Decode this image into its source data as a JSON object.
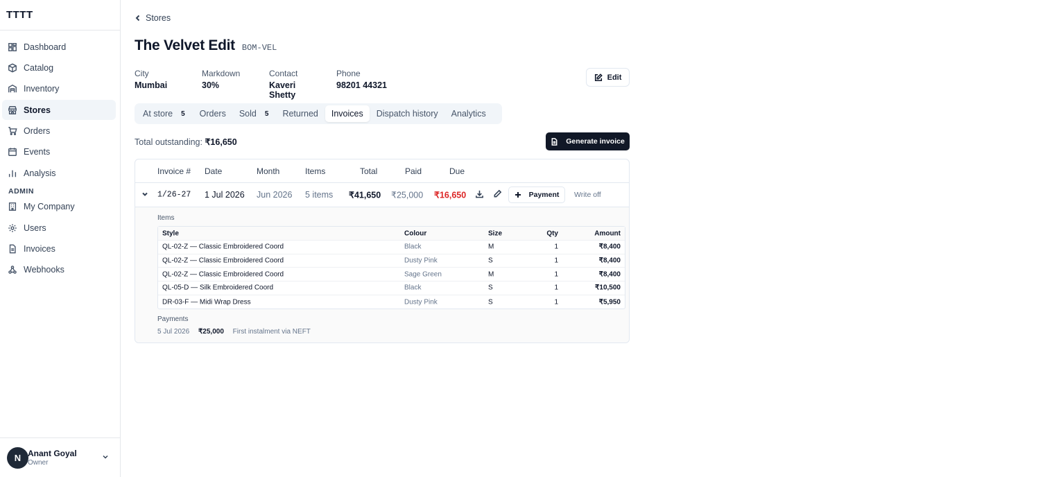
{
  "app": {
    "brand": "TTTT"
  },
  "sidebar": {
    "items": [
      {
        "label": "Dashboard",
        "icon": "dashboard-icon"
      },
      {
        "label": "Catalog",
        "icon": "package-icon"
      },
      {
        "label": "Inventory",
        "icon": "warehouse-icon"
      },
      {
        "label": "Stores",
        "icon": "store-icon",
        "active": true
      },
      {
        "label": "Orders",
        "icon": "cart-icon"
      },
      {
        "label": "Events",
        "icon": "calendar-icon"
      },
      {
        "label": "Analysis",
        "icon": "bar-chart-icon"
      }
    ],
    "admin_label": "ADMIN",
    "admin_items": [
      {
        "label": "My Company",
        "icon": "building-icon"
      },
      {
        "label": "Users",
        "icon": "gear-icon"
      },
      {
        "label": "Invoices",
        "icon": "file-icon"
      },
      {
        "label": "Webhooks",
        "icon": "webhook-icon"
      }
    ],
    "user": {
      "initial": "N",
      "name": "Anant Goyal",
      "role": "Owner"
    }
  },
  "page": {
    "back_label": "Stores",
    "title": "The Velvet Edit",
    "code": "BOM-VEL",
    "meta": [
      {
        "label": "City",
        "value": "Mumbai"
      },
      {
        "label": "Markdown",
        "value": "30%"
      },
      {
        "label": "Contact",
        "value": "Kaveri Shetty"
      },
      {
        "label": "Phone",
        "value": "98201 44321"
      }
    ],
    "edit_label": "Edit",
    "tabs": [
      {
        "label": "At store",
        "count": "5"
      },
      {
        "label": "Orders"
      },
      {
        "label": "Sold",
        "count": "5"
      },
      {
        "label": "Returned"
      },
      {
        "label": "Invoices",
        "active": true
      },
      {
        "label": "Dispatch history"
      },
      {
        "label": "Analytics"
      }
    ],
    "outstanding_label": "Total outstanding:",
    "outstanding_value": "₹16,650",
    "generate_label": "Generate invoice"
  },
  "invoices": {
    "columns": [
      "Invoice #",
      "Date",
      "Month",
      "Items",
      "Total",
      "Paid",
      "Due"
    ],
    "rows": [
      {
        "invoice": "1/26-27",
        "date": "1 Jul 2026",
        "month": "Jun 2026",
        "items": "5 items",
        "total": "₹41,650",
        "paid": "₹25,000",
        "due": "₹16,650",
        "payment_label": "Payment",
        "writeoff_label": "Write off",
        "items_label": "Items",
        "item_columns": [
          "Style",
          "Colour",
          "Size",
          "Qty",
          "Amount"
        ],
        "line_items": [
          {
            "style": "QL-02-Z — Classic Embroidered Coord",
            "colour": "Black",
            "size": "M",
            "qty": "1",
            "amount": "₹8,400"
          },
          {
            "style": "QL-02-Z — Classic Embroidered Coord",
            "colour": "Dusty Pink",
            "size": "S",
            "qty": "1",
            "amount": "₹8,400"
          },
          {
            "style": "QL-02-Z — Classic Embroidered Coord",
            "colour": "Sage Green",
            "size": "M",
            "qty": "1",
            "amount": "₹8,400"
          },
          {
            "style": "QL-05-D — Silk Embroidered Coord",
            "colour": "Black",
            "size": "S",
            "qty": "1",
            "amount": "₹10,500"
          },
          {
            "style": "DR-03-F — Midi Wrap Dress",
            "colour": "Dusty Pink",
            "size": "S",
            "qty": "1",
            "amount": "₹5,950"
          }
        ],
        "payments_label": "Payments",
        "payments": [
          {
            "date": "5 Jul 2026",
            "amount": "₹25,000",
            "note": "First instalment via NEFT"
          }
        ]
      }
    ]
  },
  "colors": {
    "accent_dark": "#111827",
    "due_red": "#dc2626",
    "active_bg": "#f1f5f9"
  }
}
